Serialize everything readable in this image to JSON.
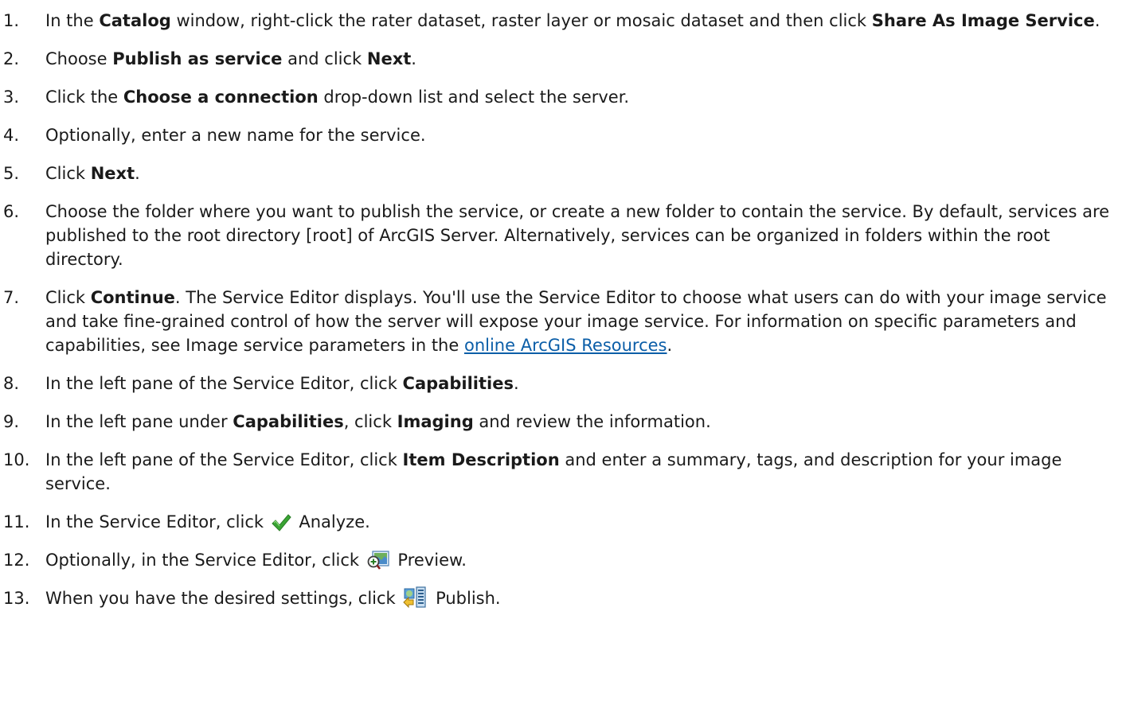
{
  "steps": [
    {
      "num": "1.",
      "parts": [
        "In the ",
        "Catalog",
        " window, right-click the rater dataset, raster layer or mosaic dataset and then click ",
        "Share As Image Service",
        "."
      ]
    },
    {
      "num": "2.",
      "parts": [
        "Choose ",
        "Publish as service",
        " and click ",
        "Next",
        "."
      ]
    },
    {
      "num": "3.",
      "parts": [
        "Click the ",
        "Choose a connection",
        " drop-down list and select the server."
      ]
    },
    {
      "num": "4.",
      "parts": [
        "Optionally, enter a new name for the service."
      ]
    },
    {
      "num": "5.",
      "parts": [
        "Click ",
        "Next",
        "."
      ]
    },
    {
      "num": "6.",
      "text": "Choose the folder where you want to publish the service, or create a new folder to contain the service. By default, services are published to the root directory [root] of ArcGIS Server. Alternatively, services can be organized in folders within the root directory."
    },
    {
      "num": "7.",
      "parts": [
        "Click ",
        "Continue",
        ". The Service Editor displays. You'll use the Service Editor to choose what users can do with your image service and take fine-grained control of how the server will expose your image service. For information on specific parameters and capabilities, see Image service parameters in the "
      ],
      "link": "online ArcGIS Resources",
      "after_link": "."
    },
    {
      "num": "8.",
      "parts": [
        "In the left pane of the Service Editor, click ",
        "Capabilities",
        "."
      ]
    },
    {
      "num": "9.",
      "parts": [
        "In the left pane under ",
        "Capabilities",
        ", click ",
        "Imaging",
        " and review the information."
      ]
    },
    {
      "num": "10.",
      "parts": [
        "In the left pane of the Service Editor, click ",
        "Item Description",
        " and enter a summary, tags, and description for your image service."
      ]
    },
    {
      "num": "11.",
      "before_icon": "In the Service Editor, click ",
      "icon": "checkmark-icon",
      "after_icon": " Analyze."
    },
    {
      "num": "12.",
      "before_icon": "Optionally, in the Service Editor, click ",
      "icon": "preview-icon",
      "after_icon": " Preview."
    },
    {
      "num": "13.",
      "before_icon": "When you have the desired settings, click ",
      "icon": "publish-icon",
      "after_icon": " Publish."
    }
  ],
  "colors": {
    "link": "#0b5ea8",
    "check": "#3aa534"
  }
}
